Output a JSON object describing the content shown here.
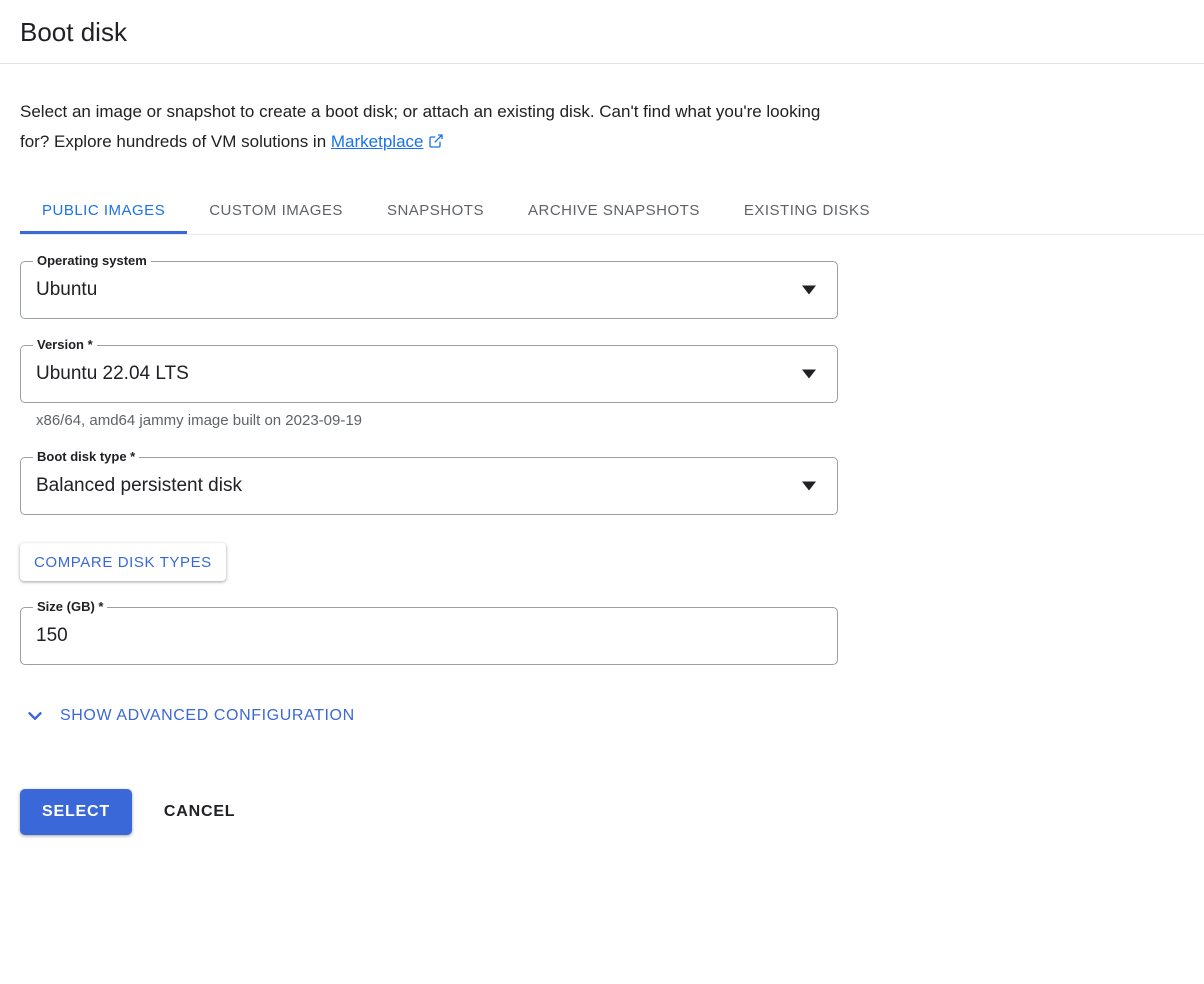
{
  "header": {
    "title": "Boot disk"
  },
  "description": {
    "text_before_link": "Select an image or snapshot to create a boot disk; or attach an existing disk. Can't find what you're looking for? Explore hundreds of VM solutions in ",
    "link_label": "Marketplace",
    "link_icon": "external-link-icon"
  },
  "tabs": [
    {
      "label": "PUBLIC IMAGES",
      "active": true
    },
    {
      "label": "CUSTOM IMAGES",
      "active": false
    },
    {
      "label": "SNAPSHOTS",
      "active": false
    },
    {
      "label": "ARCHIVE SNAPSHOTS",
      "active": false
    },
    {
      "label": "EXISTING DISKS",
      "active": false
    }
  ],
  "form": {
    "operating_system": {
      "label": "Operating system",
      "value": "Ubuntu",
      "arrow_icon": "chevron-down-icon"
    },
    "version": {
      "label": "Version *",
      "value": "Ubuntu 22.04 LTS",
      "helper": "x86/64, amd64 jammy image built on 2023-09-19",
      "arrow_icon": "chevron-down-icon"
    },
    "boot_disk_type": {
      "label": "Boot disk type *",
      "value": "Balanced persistent disk",
      "arrow_icon": "chevron-down-icon"
    },
    "compare_button": {
      "label": "COMPARE DISK TYPES"
    },
    "size": {
      "label": "Size (GB) *",
      "value": "150"
    },
    "advanced": {
      "label": "SHOW ADVANCED CONFIGURATION",
      "icon": "chevron-down-icon"
    }
  },
  "actions": {
    "select_label": "SELECT",
    "cancel_label": "CANCEL"
  },
  "colors": {
    "accent_blue": "#3b68d8",
    "link_blue": "#1a73e8",
    "tab_inactive": "#5f6368",
    "text_primary": "#202124",
    "helper_gray": "#5f6368",
    "divider": "#e0e0e0",
    "field_border": "#9aa0a6"
  }
}
